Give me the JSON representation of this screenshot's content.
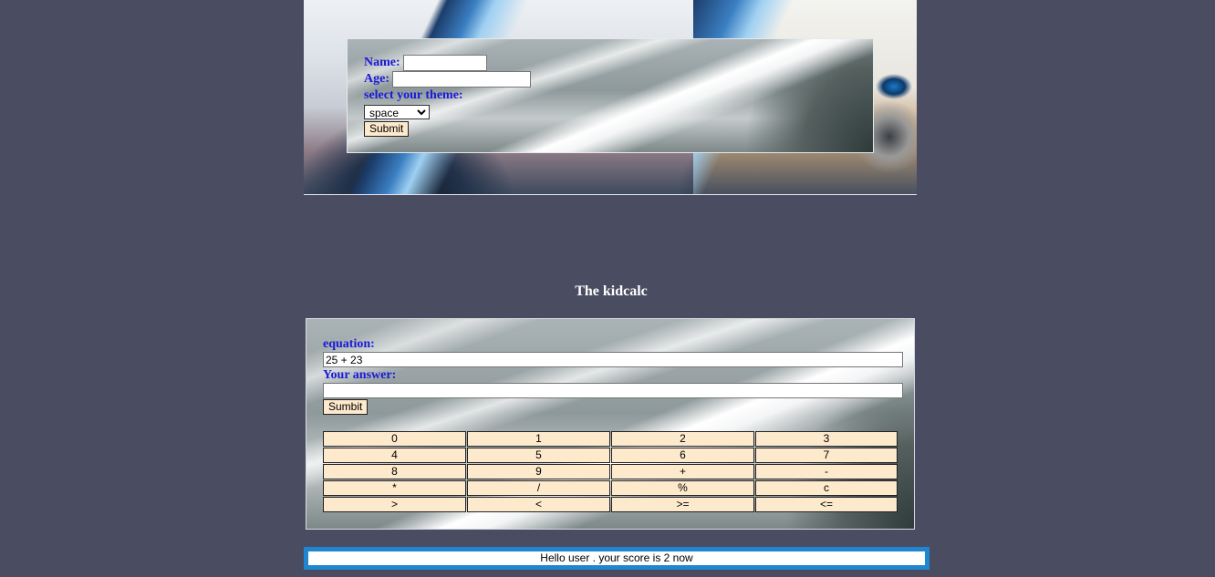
{
  "form": {
    "name_label": "Name:",
    "name_value": "",
    "age_label": "Age:",
    "age_value": "",
    "theme_label": "select your theme:",
    "theme_selected": "space",
    "submit_label": "Submit"
  },
  "heading": "The kidcalc",
  "calculator": {
    "equation_label": "equation:",
    "equation_value": "25 + 23",
    "answer_label": "Your answer:",
    "answer_value": "",
    "submit_label": "Sumbit",
    "keys": [
      "0",
      "1",
      "2",
      "3",
      "4",
      "5",
      "6",
      "7",
      "8",
      "9",
      "+",
      "-",
      "*",
      "/",
      "%",
      "c",
      ">",
      "<",
      ">=",
      "<="
    ]
  },
  "status": {
    "text": "Hello user . your score is 2 now"
  },
  "colors": {
    "background": "#4a4d62",
    "label_blue": "#1a1ad6",
    "key_fill": "#fde9cc",
    "status_border": "#1f87d0"
  }
}
